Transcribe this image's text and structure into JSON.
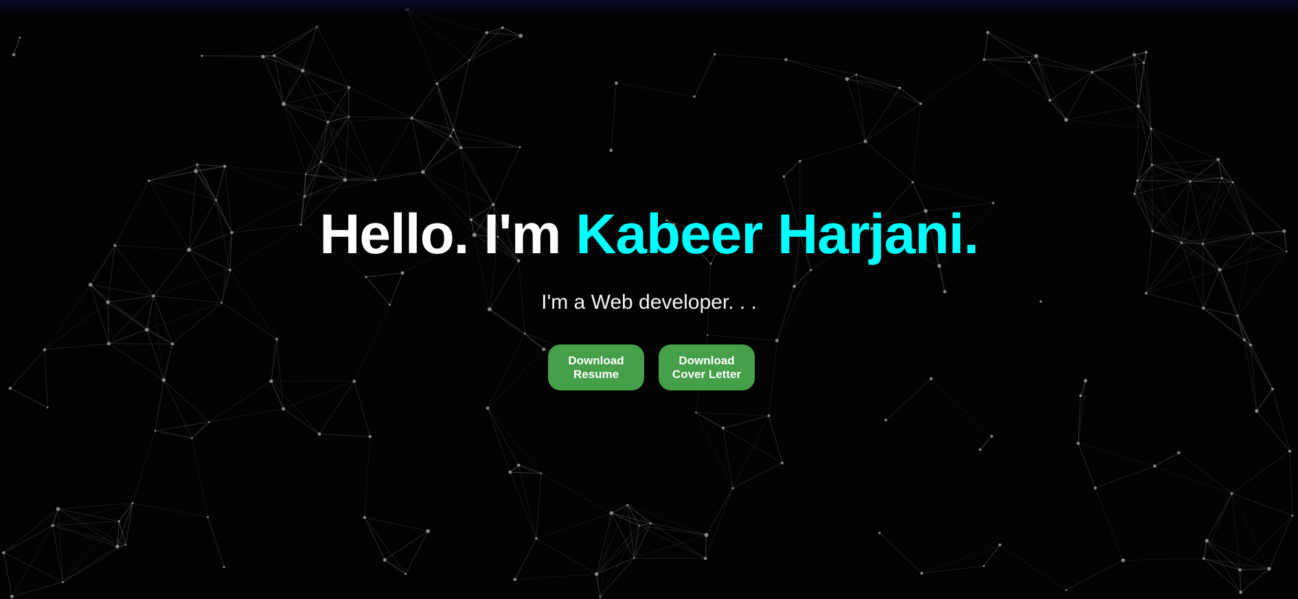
{
  "hero": {
    "greeting": "Hello. I'm ",
    "name": "Kabeer Harjani.",
    "subtitle": "I'm a Web developer. . .",
    "buttons": {
      "resume_line1": "Download",
      "resume_line2": "Resume",
      "cover_line1": "Download",
      "cover_line2": "Cover Letter"
    }
  },
  "colors": {
    "background": "#030303",
    "name_accent": "#00ffff",
    "button": "#45a049",
    "network_line": "#8a8a8a",
    "network_node": "#9a9a9a"
  }
}
